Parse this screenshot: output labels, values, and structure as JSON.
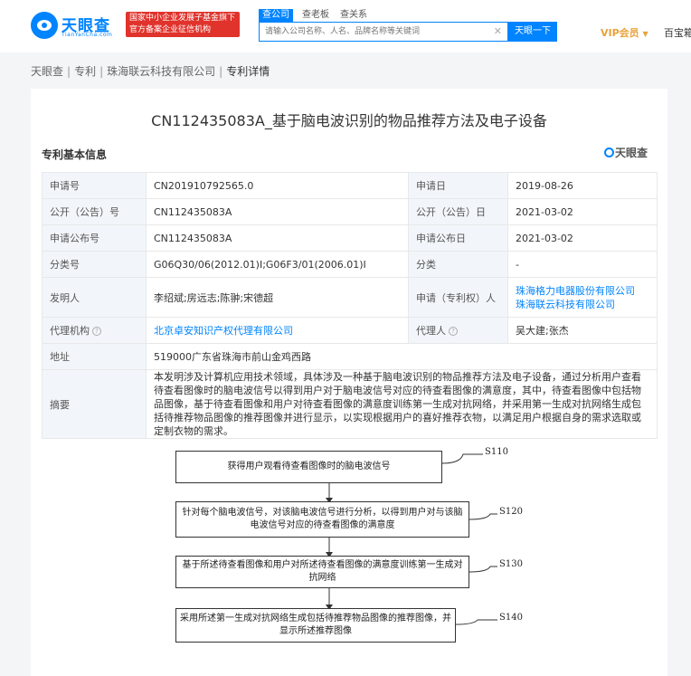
{
  "header": {
    "logo_text": "天眼查",
    "logo_sub": "TianYanCha.com",
    "gov_badge_line1": "国家中小企业发展子基金旗下",
    "gov_badge_line2": "官方备案企业征信机构",
    "tabs": [
      {
        "label": "查公司"
      },
      {
        "label": "查老板"
      },
      {
        "label": "查关系"
      }
    ],
    "search_placeholder": "请输入公司名称、人名、品牌名称等关键词",
    "search_button": "天眼一下",
    "vip_label": "VIP会员",
    "baibox_label": "百宝箱"
  },
  "breadcrumb": [
    "天眼查",
    "专利",
    "珠海联云科技有限公司",
    "专利详情"
  ],
  "page_title": "CN112435083A_基于脑电波识别的物品推荐方法及电子设备",
  "section_title": "专利基本信息",
  "watermark": "天眼查",
  "info": {
    "application_no_label": "申请号",
    "application_no": "CN201910792565.0",
    "application_date_label": "申请日",
    "application_date": "2019-08-26",
    "publication_no_label": "公开（公告）号",
    "publication_no": "CN112435083A",
    "publication_date_label": "公开（公告）日",
    "publication_date": "2021-03-02",
    "grant_no_label": "申请公布号",
    "grant_no": "CN112435083A",
    "grant_date_label": "申请公布日",
    "grant_date": "2021-03-02",
    "classification_label": "分类号",
    "classification": "G06Q30/06(2012.01)I;G06F3/01(2006.01)I",
    "category_label": "分类",
    "category": "-",
    "inventors_label": "发明人",
    "inventors": "李绍斌;房远志;陈翀;宋德超",
    "applicant_label": "申请（专利权）人",
    "applicant_1": "珠海格力电器股份有限公司",
    "applicant_2": "珠海联云科技有限公司",
    "agency_label": "代理机构",
    "agency": "北京卓安知识产权代理有限公司",
    "agent_label": "代理人",
    "agent": "吴大建;张杰",
    "address_label": "地址",
    "address": "519000广东省珠海市前山金鸡西路",
    "abstract_label": "摘要",
    "abstract": "本发明涉及计算机应用技术领域，具体涉及一种基于脑电波识别的物品推荐方法及电子设备，通过分析用户查看待查看图像时的脑电波信号以得到用户对于脑电波信号对应的待查看图像的满意度，其中，待查看图像中包括物品图像，基于待查看图像和用户对待查看图像的满意度训练第一生成对抗网络，并采用第一生成对抗网络生成包括待推荐物品图像的推荐图像并进行显示，以实现根据用户的喜好推荐衣物，以满足用户根据自身的需求选取或定制衣物的需求。"
  },
  "flowchart": {
    "steps": [
      {
        "label": "S110",
        "text": "获得用户观看待查看图像时的脑电波信号"
      },
      {
        "label": "S120",
        "text": "针对每个脑电波信号，对该脑电波信号进行分析，以得到用户对与该脑电波信号对应的待查看图像的满意度"
      },
      {
        "label": "S130",
        "text": "基于所述待查看图像和用户对所述待查看图像的满意度训练第一生成对抗网络"
      },
      {
        "label": "S140",
        "text": "采用所述第一生成对抗网络生成包括待推荐物品图像的推荐图像，并显示所述推荐图像"
      }
    ]
  },
  "colors": {
    "accent": "#0084ff",
    "badge_red": "#e0332c",
    "vip_gold": "#e9a23b",
    "label_bg": "#f2f6fb"
  }
}
